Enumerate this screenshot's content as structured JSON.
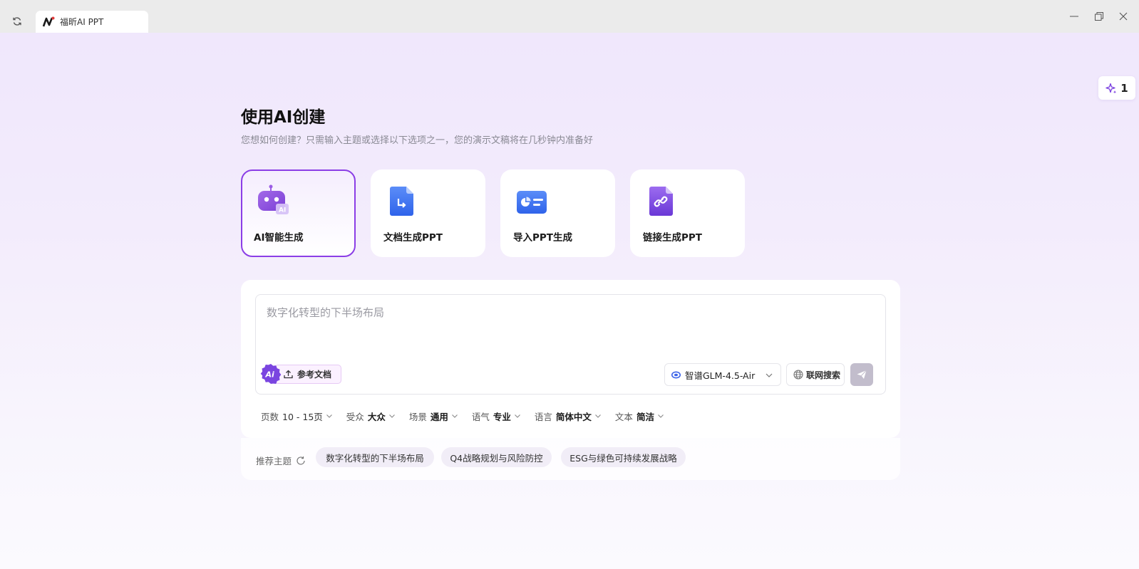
{
  "window": {
    "tab_title": "福昕AI PPT"
  },
  "credits": {
    "count": "1"
  },
  "header": {
    "title": "使用AI创建",
    "subtitle": "您想如何创建？只需输入主题或选择以下选项之一，您的演示文稿将在几秒钟内准备好"
  },
  "modes": [
    {
      "label": "AI智能生成",
      "icon": "robot-ai-icon",
      "active": true
    },
    {
      "label": "文档生成PPT",
      "icon": "document-icon",
      "active": false
    },
    {
      "label": "导入PPT生成",
      "icon": "import-ppt-icon",
      "active": false
    },
    {
      "label": "链接生成PPT",
      "icon": "link-document-icon",
      "active": false
    }
  ],
  "composer": {
    "placeholder": "数字化转型的下半场布局",
    "value": "",
    "ref_doc_label": "参考文档",
    "model": "智谱GLM-4.5-Air",
    "web_search_label": "联网搜索"
  },
  "options": [
    {
      "label": "页数",
      "value": "10 - 15页"
    },
    {
      "label": "受众",
      "value": "大众"
    },
    {
      "label": "场景",
      "value": "通用"
    },
    {
      "label": "语气",
      "value": "专业"
    },
    {
      "label": "语言",
      "value": "简体中文"
    },
    {
      "label": "文本",
      "value": "简洁"
    }
  ],
  "recommend": {
    "label": "推荐主题",
    "topics": [
      "数字化转型的下半场布局",
      "Q4战略规划与风险防控",
      "ESG与绿色可持续发展战略"
    ]
  },
  "colors": {
    "accent": "#8b3ee6",
    "send_disabled": "#c2bdcc"
  }
}
